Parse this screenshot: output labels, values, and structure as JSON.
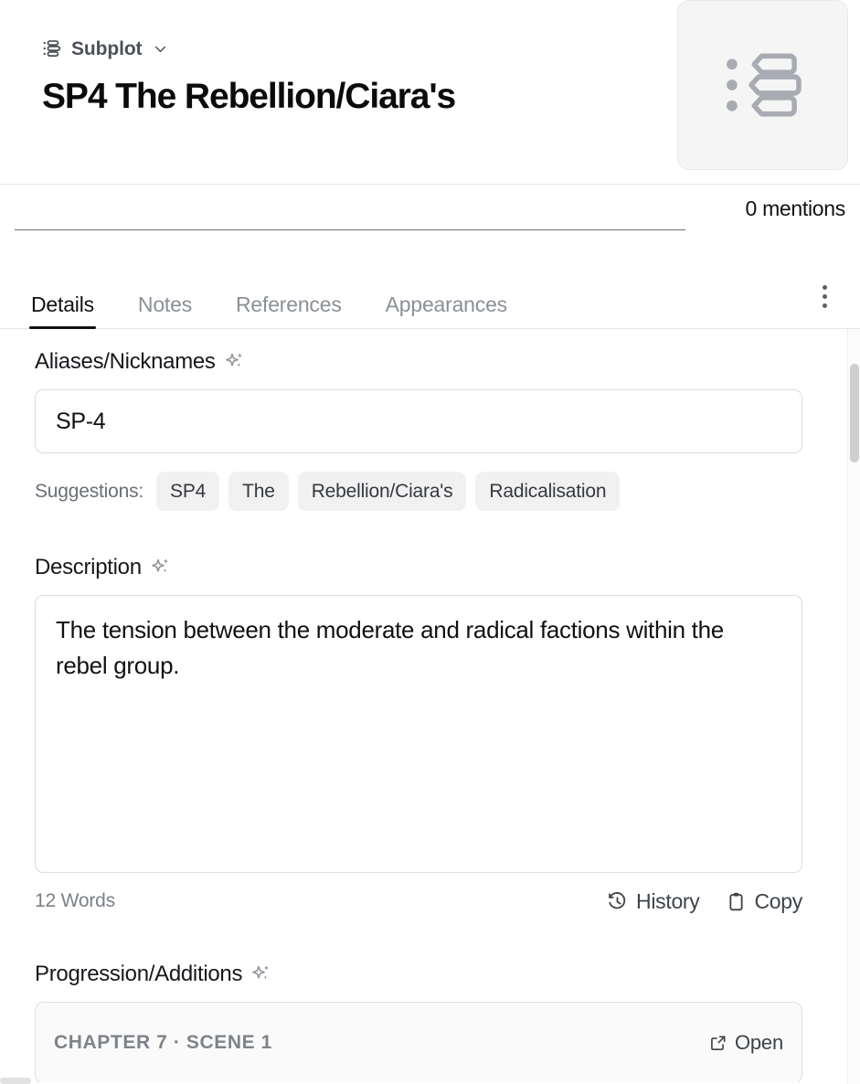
{
  "header": {
    "type_label": "Subplot",
    "type_icon": "list-bullets-icon",
    "chevron_icon": "chevron-down-icon",
    "title": "SP4 The Rebellion/Ciara's",
    "badge_icon": "subplot-list-icon"
  },
  "meta": {
    "mention_input_value": "",
    "mention_input_placeholder": "",
    "mentions_count": "0 mentions"
  },
  "tabs": {
    "items": [
      {
        "label": "Details",
        "active": true
      },
      {
        "label": "Notes",
        "active": false
      },
      {
        "label": "References",
        "active": false
      },
      {
        "label": "Appearances",
        "active": false
      }
    ],
    "overflow_icon": "more-vertical-icon"
  },
  "aliases": {
    "label": "Aliases/Nicknames",
    "ai_icon": "sparkle-icon",
    "value": "SP-4",
    "placeholder": "",
    "suggestions_label": "Suggestions:",
    "suggestions": [
      "SP4",
      "The",
      "Rebellion/Ciara's",
      "Radicalisation"
    ]
  },
  "description": {
    "label": "Description",
    "ai_icon": "sparkle-icon",
    "value": "The tension between the moderate and radical factions within the rebel group.",
    "placeholder": "",
    "word_count": "12 Words",
    "history_label": "History",
    "history_icon": "clock-rewind-icon",
    "copy_label": "Copy",
    "copy_icon": "clipboard-icon"
  },
  "progression": {
    "label": "Progression/Additions",
    "ai_icon": "sparkle-icon",
    "entries": [
      {
        "title": "CHAPTER 7 · SCENE 1",
        "open_label": "Open",
        "open_icon": "external-link-icon"
      }
    ]
  },
  "colors": {
    "accent": "#111111",
    "muted": "#8b9097",
    "chip_bg": "#f1f1f2",
    "border": "#dcdcdf",
    "badge_bg": "#f5f5f6",
    "icon_gray": "#a8abb1"
  }
}
